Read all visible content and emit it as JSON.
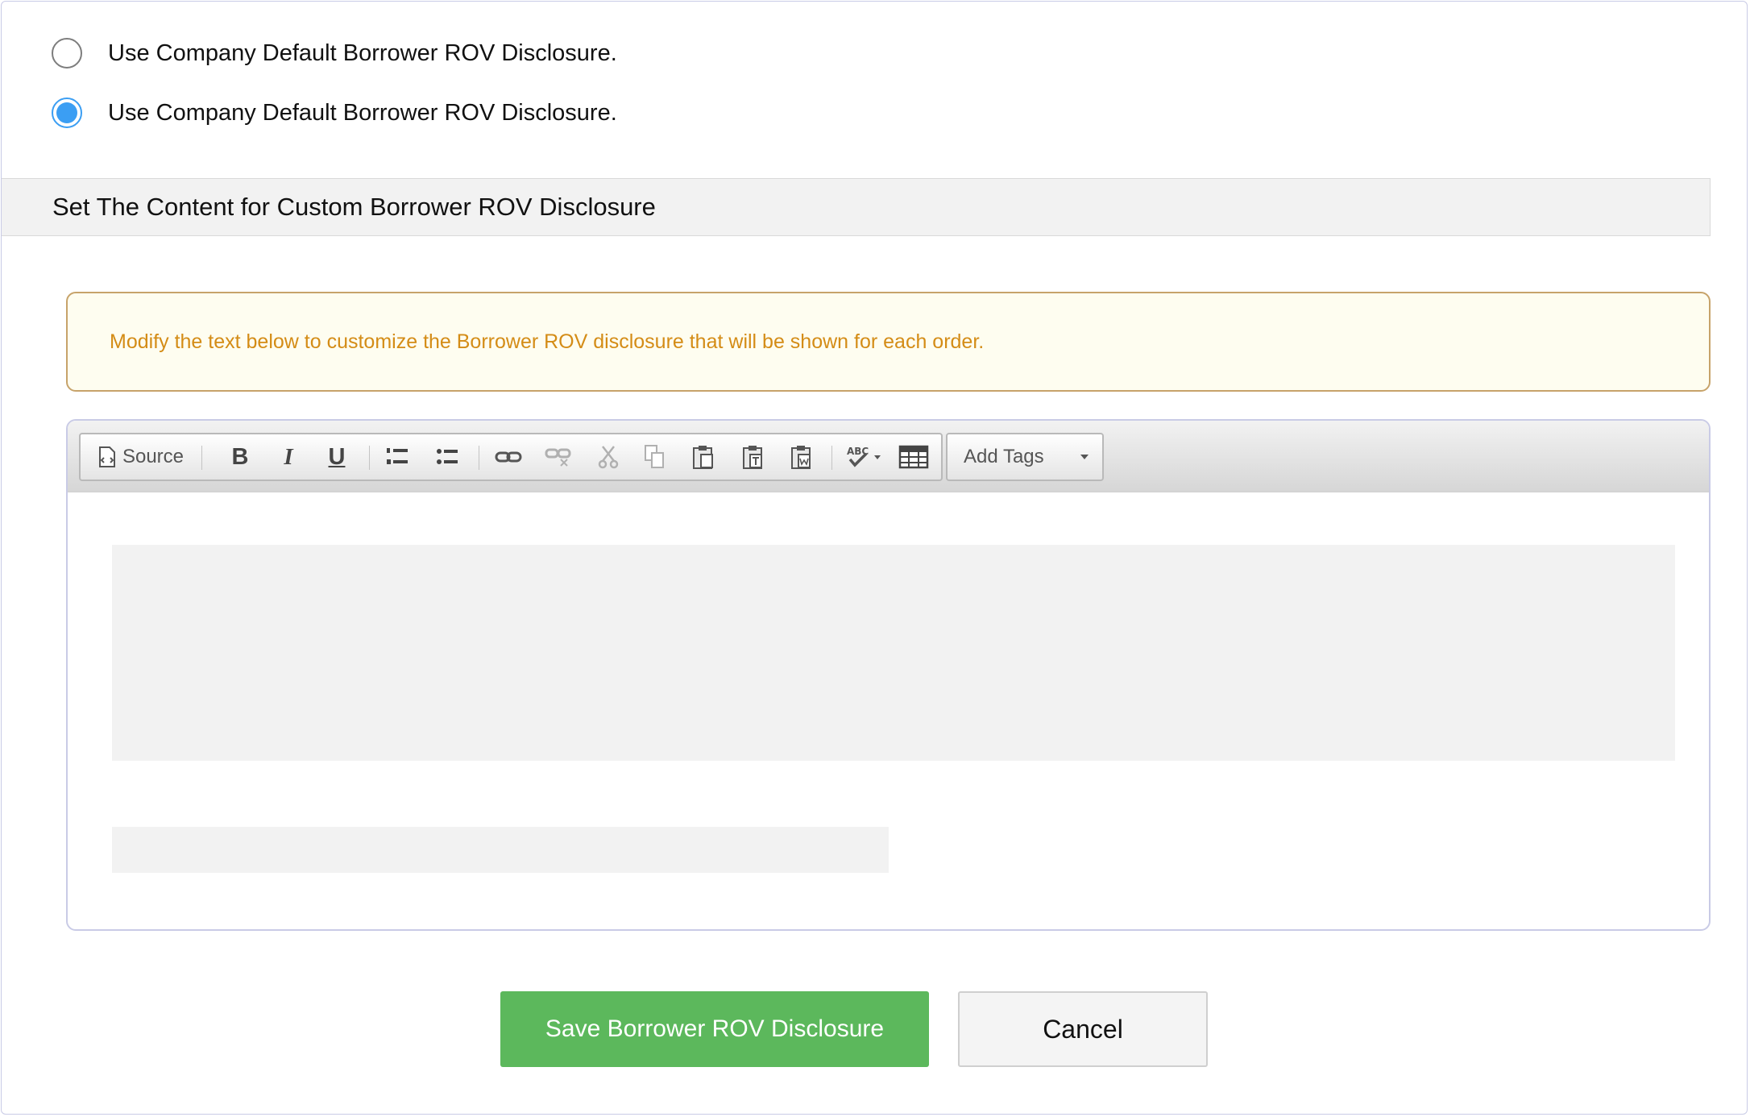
{
  "options": [
    {
      "label": "Use Company Default Borrower ROV Disclosure.",
      "checked": false
    },
    {
      "label": "Use Company Default Borrower ROV Disclosure.",
      "checked": true
    }
  ],
  "section": {
    "title": "Set The Content for Custom Borrower ROV Disclosure"
  },
  "notice": {
    "text": "Modify the text below to customize the Borrower ROV disclosure that will be shown for each order."
  },
  "toolbar": {
    "source_label": "Source",
    "bold_label": "B",
    "italic_label": "I",
    "underline_label": "U",
    "add_tags_label": "Add Tags"
  },
  "buttons": {
    "save_label": "Save Borrower ROV Disclosure",
    "cancel_label": "Cancel"
  },
  "colors": {
    "accent_radio": "#3b9ef3",
    "save_green": "#5cb85c",
    "notice_text": "#d48c16",
    "notice_border": "#c7a36a"
  }
}
